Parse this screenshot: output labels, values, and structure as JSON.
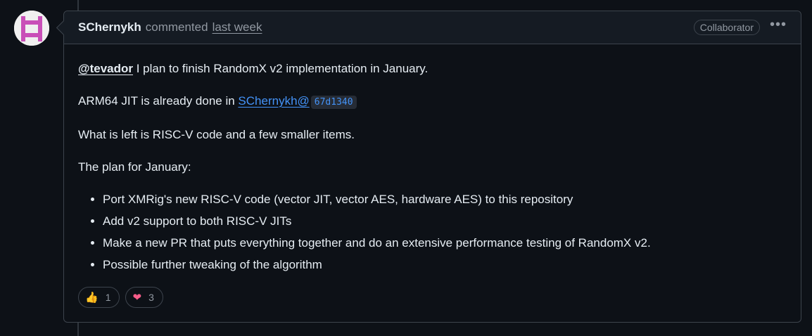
{
  "comment": {
    "author": "SChernykh",
    "action": "commented",
    "timestamp": "last week",
    "badge": "Collaborator",
    "menu_glyph": "•••"
  },
  "body": {
    "p1_mention": "@tevador",
    "p1_text": " I plan to finish RandomX v2 implementation in January.",
    "p2_text": "ARM64 JIT is already done in ",
    "p2_link": "SChernykh@",
    "p2_sha": "67d1340",
    "p3_text": "What is left is RISC-V code and a few smaller items.",
    "p4_text": "The plan for January:",
    "plan_items": [
      "Port XMRig's new RISC-V code (vector JIT, vector AES, hardware AES) to this repository",
      "Add v2 support to both RISC-V JITs",
      "Make a new PR that puts everything together and do an extensive performance testing of RandomX v2.",
      "Possible further tweaking of the algorithm"
    ]
  },
  "reactions": [
    {
      "icon": "thumbs-up-icon",
      "glyph": "👍",
      "count": "1",
      "color": "#f5b400"
    },
    {
      "icon": "heart-icon",
      "glyph": "❤",
      "count": "3",
      "color": "#f85d8a"
    }
  ],
  "colors": {
    "background": "#0d1117",
    "header": "#151b23",
    "border": "#3d444d",
    "link": "#4493f8",
    "muted": "#9198a1",
    "avatar_pattern": "#c94fb8"
  }
}
